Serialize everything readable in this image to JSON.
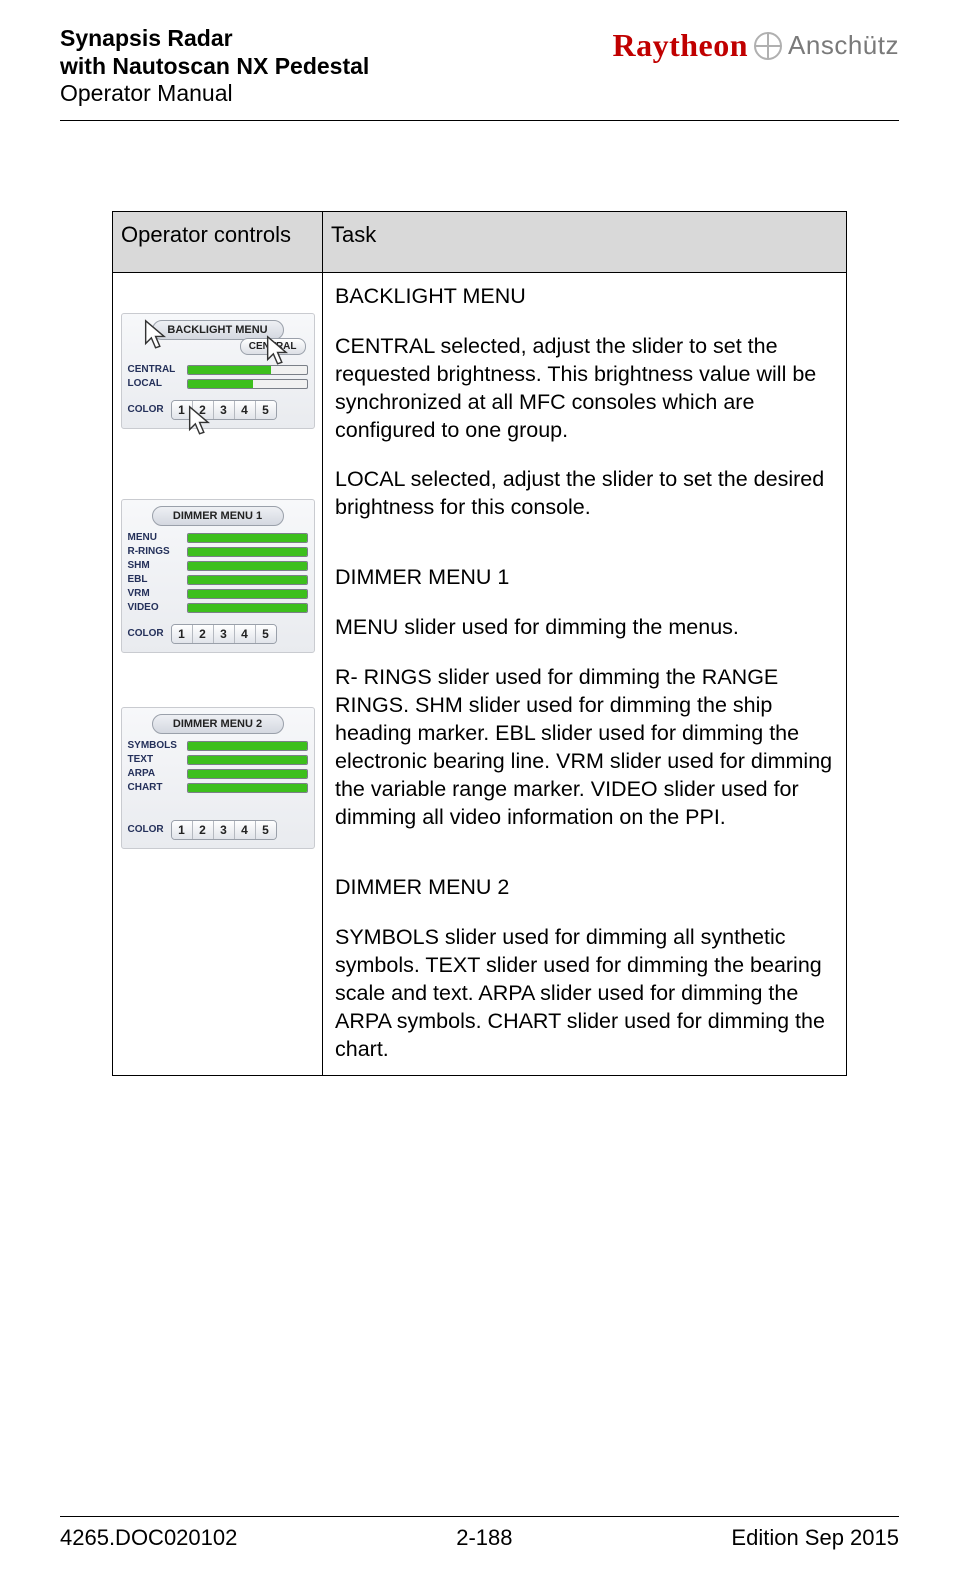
{
  "header": {
    "title_line1": "Synapsis Radar",
    "title_line2": "with Nautoscan NX Pedestal",
    "subtitle": "Operator Manual",
    "brand1": "Raytheon",
    "brand2": "Anschütz"
  },
  "table": {
    "header_left": "Operator controls",
    "header_right": "Task"
  },
  "panels": {
    "backlight": {
      "title": "BACKLIGHT MENU",
      "central_btn": "CENTRAL",
      "rows": [
        {
          "label": "CENTRAL",
          "fill": 70
        },
        {
          "label": "LOCAL",
          "fill": 55
        }
      ],
      "color_label": "COLOR",
      "colors": [
        "1",
        "2",
        "3",
        "4",
        "5"
      ]
    },
    "dimmer1": {
      "title": "DIMMER MENU 1",
      "rows": [
        {
          "label": "MENU",
          "fill": 100
        },
        {
          "label": "R-RINGS",
          "fill": 100
        },
        {
          "label": "SHM",
          "fill": 100
        },
        {
          "label": "EBL",
          "fill": 100
        },
        {
          "label": "VRM",
          "fill": 100
        },
        {
          "label": "VIDEO",
          "fill": 100
        }
      ],
      "color_label": "COLOR",
      "colors": [
        "1",
        "2",
        "3",
        "4",
        "5"
      ]
    },
    "dimmer2": {
      "title": "DIMMER MENU 2",
      "rows": [
        {
          "label": "SYMBOLS",
          "fill": 100
        },
        {
          "label": "TEXT",
          "fill": 100
        },
        {
          "label": "ARPA",
          "fill": 100
        },
        {
          "label": "CHART",
          "fill": 100
        }
      ],
      "color_label": "COLOR",
      "colors": [
        "1",
        "2",
        "3",
        "4",
        "5"
      ]
    }
  },
  "task": {
    "backlight_heading": "BACKLIGHT MENU",
    "backlight_p1": "CENTRAL selected, adjust the slider to set the requested brightness. This brightness value will be synchronized at all MFC consoles which are configured to one group.",
    "backlight_p2": "LOCAL selected, adjust the slider to set the desired brightness for this console.",
    "dimmer1_heading": "DIMMER MENU 1",
    "dimmer1_p1": "MENU slider used for dimming the menus.",
    "dimmer1_p2": "R- RINGS slider used for dimming the RANGE RINGS. SHM slider used for dimming the ship heading marker. EBL slider used for dimming the electronic bearing line. VRM slider used for dimming the variable range marker. VIDEO slider used for dimming all video information on the PPI.",
    "dimmer2_heading": "DIMMER MENU 2",
    "dimmer2_p1": "SYMBOLS slider used for dimming all synthetic symbols. TEXT slider used for dimming the bearing scale and text. ARPA slider used for dimming the ARPA symbols. CHART slider used for dimming the chart."
  },
  "footer": {
    "docnum": "4265.DOC020102",
    "page": "2-188",
    "edition": "Edition Sep 2015"
  }
}
